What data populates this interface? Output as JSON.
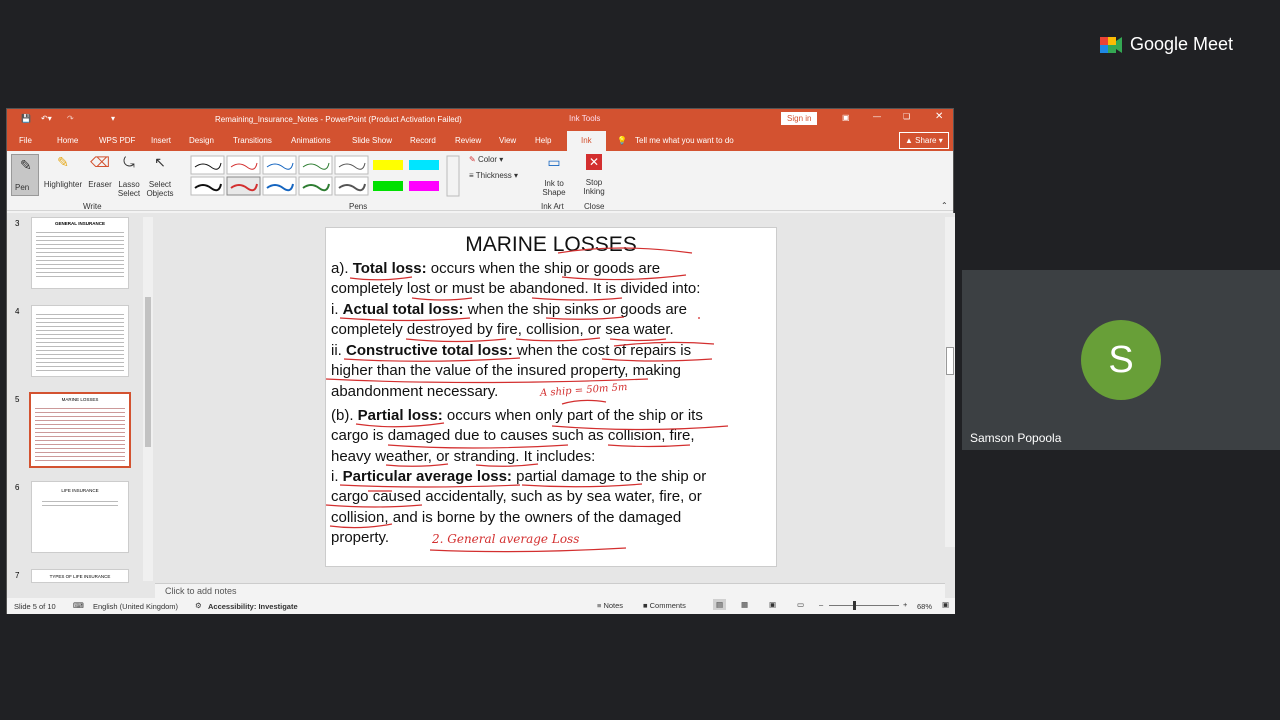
{
  "meet": {
    "brand": "Google Meet",
    "participant_name": "Samson Popoola",
    "participant_initial": "S",
    "avatar_color": "#689f38"
  },
  "ppt": {
    "window_title": "Remaining_Insurance_Notes  -  PowerPoint (Product Activation Failed)",
    "context_tab": "Ink Tools",
    "sign_in": "Sign in",
    "tabs": [
      "File",
      "Home",
      "WPS PDF",
      "Insert",
      "Design",
      "Transitions",
      "Animations",
      "Slide Show",
      "Record",
      "Review",
      "View",
      "Help",
      "Ink"
    ],
    "tell_me": "Tell me what you want to do",
    "share": "Share",
    "ribbon": {
      "pen": "Pen",
      "highlighter": "Highlighter",
      "eraser": "Eraser",
      "lasso1": "Lasso",
      "lasso2": "Select",
      "select1": "Select",
      "select2": "Objects",
      "group_write": "Write",
      "group_pens": "Pens",
      "color": "Color",
      "thickness": "Thickness",
      "ink_shape1": "Ink to",
      "ink_shape2": "Shape",
      "group_inkart": "Ink Art",
      "stop1": "Stop",
      "stop2": "Inking",
      "group_close": "Close"
    },
    "thumbnails": [
      {
        "num": "3",
        "title": "GENERAL INSURANCE"
      },
      {
        "num": "4",
        "title": ""
      },
      {
        "num": "5",
        "title": "MARINE LOSSES"
      },
      {
        "num": "6",
        "title": "LIFE INSURANCE"
      },
      {
        "num": "7",
        "title": "TYPES OF LIFE INSURANCE"
      }
    ],
    "slide": {
      "title": "MARINE LOSSES",
      "l1a": "a). ",
      "l1b": "Total loss:",
      "l1c": " occurs when the ship or goods are",
      "l2": "completely lost or must be abandoned. It is divided into:",
      "l3a": "i. ",
      "l3b": "Actual total loss:",
      "l3c": " when the ship sinks or goods are",
      "l4": "completely destroyed by fire, collision, or sea water.",
      "l5a": "ii. ",
      "l5b": "Constructive total loss:",
      "l5c": " when the cost of repairs is",
      "l6": "higher than the value of the insured property, making",
      "l7": "abandonment necessary.",
      "l8a": "(b). ",
      "l8b": "Partial loss:",
      "l8c": " occurs when only part of the ship or its",
      "l9": "cargo is damaged due to causes such as collision, fire,",
      "l10": "heavy weather, or stranding. It includes:",
      "l11a": "i. ",
      "l11b": "Particular average loss:",
      "l11c": " partial damage to the ship or",
      "l12": "cargo caused accidentally, such as by sea water, fire, or",
      "l13": "collision, and is borne by the owners of the damaged",
      "l14": "property.",
      "ink_note1": "A ship = 50m  5m",
      "ink_note2": "2. General average Loss"
    },
    "notes_placeholder": "Click to add notes",
    "status": {
      "slide": "Slide 5 of 10",
      "language": "English (United Kingdom)",
      "accessibility": "Accessibility: Investigate",
      "notes": "Notes",
      "comments": "Comments",
      "zoom": "68%"
    }
  }
}
